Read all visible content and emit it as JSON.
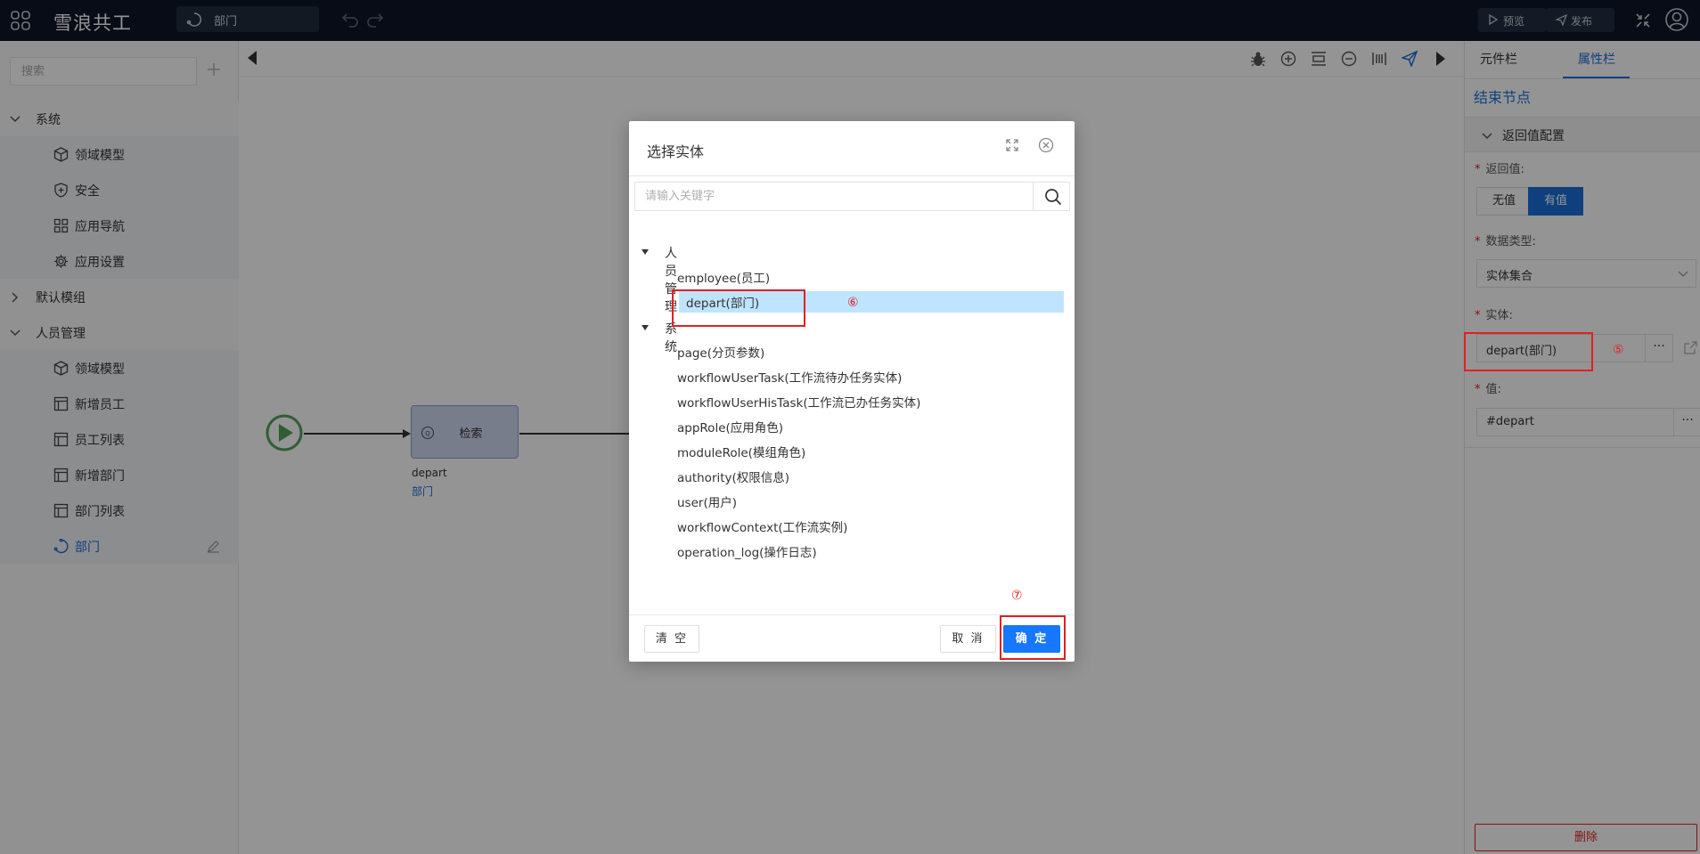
{
  "topbar": {
    "app_title": "雪浪共工",
    "page_tab_label": "部门",
    "preview_label": "预览",
    "publish_label": "发布"
  },
  "sidebar": {
    "search_placeholder": "搜索",
    "groups": [
      {
        "label": "系统",
        "expanded": true,
        "items": [
          {
            "label": "领域模型",
            "icon": "cube-icon"
          },
          {
            "label": "安全",
            "icon": "shield-plus-icon"
          },
          {
            "label": "应用导航",
            "icon": "grid-icon"
          },
          {
            "label": "应用设置",
            "icon": "gear-icon"
          }
        ]
      },
      {
        "label": "默认模组",
        "expanded": false,
        "items": []
      },
      {
        "label": "人员管理",
        "expanded": true,
        "items": [
          {
            "label": "领域模型",
            "icon": "cube-icon"
          },
          {
            "label": "新增员工",
            "icon": "table-icon"
          },
          {
            "label": "员工列表",
            "icon": "table-icon"
          },
          {
            "label": "新增部门",
            "icon": "table-icon"
          },
          {
            "label": "部门列表",
            "icon": "table-icon"
          },
          {
            "label": "部门",
            "icon": "flow-icon",
            "active": true
          }
        ]
      }
    ]
  },
  "canvas": {
    "task_node_label": "检索",
    "task_node_var": "depart",
    "task_node_entity": "部门"
  },
  "right_panel": {
    "tab_components": "元件栏",
    "tab_properties": "属性栏",
    "title": "结束节点",
    "section_label": "返回值配置",
    "return_value_label": "返回值:",
    "option_none": "无值",
    "option_has": "有值",
    "data_type_label": "数据类型:",
    "data_type_value": "实体集合",
    "entity_label": "实体:",
    "entity_value": "depart(部门)",
    "value_label": "值:",
    "value_value": "#depart",
    "dots": "···",
    "delete_label": "删除"
  },
  "dialog": {
    "title": "选择实体",
    "search_placeholder": "请输入关键字",
    "groups": [
      {
        "label": "人员管理",
        "items": [
          "employee(员工)",
          "depart(部门)"
        ]
      },
      {
        "label": "系统",
        "items": [
          "page(分页参数)",
          "workflowUserTask(工作流待办任务实体)",
          "workflowUserHisTask(工作流已办任务实体)",
          "appRole(应用角色)",
          "moduleRole(模组角色)",
          "authority(权限信息)",
          "user(用户)",
          "workflowContext(工作流实例)",
          "operation_log(操作日志)"
        ]
      }
    ],
    "selected": "depart(部门)",
    "clear_label": "清 空",
    "cancel_label": "取 消",
    "ok_label": "确 定"
  },
  "annotations": {
    "five": "⑤",
    "six": "⑥",
    "seven": "⑦"
  },
  "colors": {
    "topbar_bg": "#0d1626",
    "accent": "#1a6fd8",
    "primary_button": "#1677ff",
    "selection_bg": "#bfe4ff",
    "annotation_red": "#e02020",
    "start_node_green": "#52a35a"
  }
}
